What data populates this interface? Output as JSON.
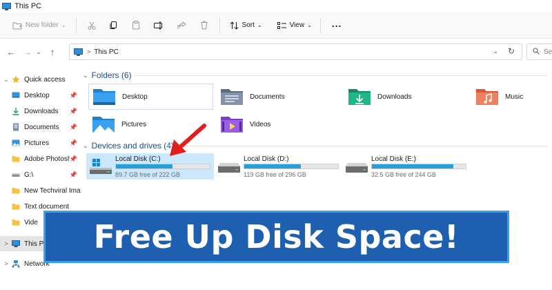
{
  "window": {
    "title": "This PC"
  },
  "toolbar": {
    "new_folder": "New folder",
    "sort": "Sort",
    "view": "View",
    "more": "..."
  },
  "address": {
    "path": "This PC",
    "search_placeholder": "Se"
  },
  "sidebar": {
    "items": [
      {
        "label": "Quick access"
      },
      {
        "label": "Desktop"
      },
      {
        "label": "Downloads"
      },
      {
        "label": "Documents"
      },
      {
        "label": "Pictures"
      },
      {
        "label": "Adobe Photosh"
      },
      {
        "label": "G:\\"
      },
      {
        "label": "New Techviral Ima"
      },
      {
        "label": "Text document"
      },
      {
        "label": "Vide"
      },
      {
        "label": "This P"
      },
      {
        "label": "Network"
      }
    ]
  },
  "folders": {
    "header": "Folders (6)",
    "items": [
      {
        "name": "Desktop"
      },
      {
        "name": "Documents"
      },
      {
        "name": "Downloads"
      },
      {
        "name": "Music"
      },
      {
        "name": "Pictures"
      },
      {
        "name": "Videos"
      }
    ]
  },
  "drives": {
    "header": "Devices and drives (4)",
    "items": [
      {
        "name": "Local Disk (C:)",
        "free_text": "89.7 GB free of 222 GB",
        "used_fraction": 0.6
      },
      {
        "name": "Local Disk (D:)",
        "free_text": "119 GB free of 296 GB",
        "used_fraction": 0.6
      },
      {
        "name": "Local Disk (E:)",
        "free_text": "32.5 GB free of 244 GB",
        "used_fraction": 0.87
      }
    ]
  },
  "banner": {
    "text": "Free Up Disk Space!"
  },
  "colors": {
    "accent": "#26a0da",
    "banner_bg": "#1e5fb0",
    "banner_border": "#3ba0ea",
    "arrow": "#e0201c"
  }
}
